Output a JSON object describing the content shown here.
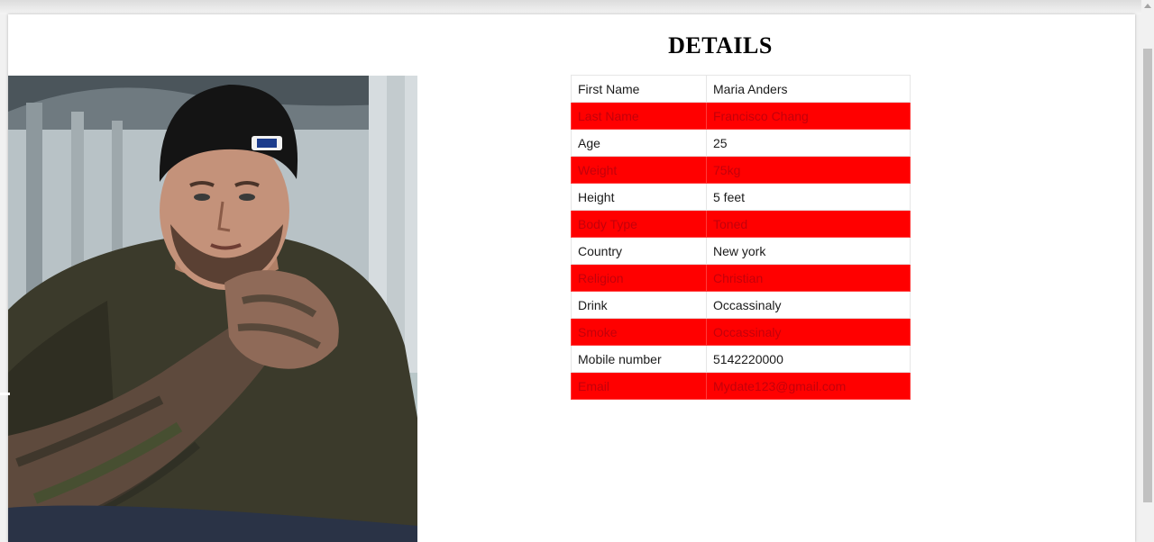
{
  "page": {
    "title": "DETAILS"
  },
  "profile_photo": {
    "description_icon": "person-photo"
  },
  "details": [
    {
      "label": "First Name",
      "value": "Maria Anders"
    },
    {
      "label": "Last Name",
      "value": "Francisco Chang"
    },
    {
      "label": "Age",
      "value": "25"
    },
    {
      "label": "Weight",
      "value": "75kg"
    },
    {
      "label": "Height",
      "value": "5 feet"
    },
    {
      "label": "Body Type",
      "value": "Toned"
    },
    {
      "label": "Country",
      "value": "New york"
    },
    {
      "label": "Religion",
      "value": "Christian"
    },
    {
      "label": "Drink",
      "value": "Occassinaly"
    },
    {
      "label": "Smoke",
      "value": "Occassinaly"
    },
    {
      "label": "Mobile number",
      "value": "5142220000"
    },
    {
      "label": "Email",
      "value": "Mydate123@gmail.com"
    }
  ],
  "colors": {
    "stripe": "#ff0000",
    "stripe_text": "#c4000a",
    "background": "#ffffff"
  }
}
